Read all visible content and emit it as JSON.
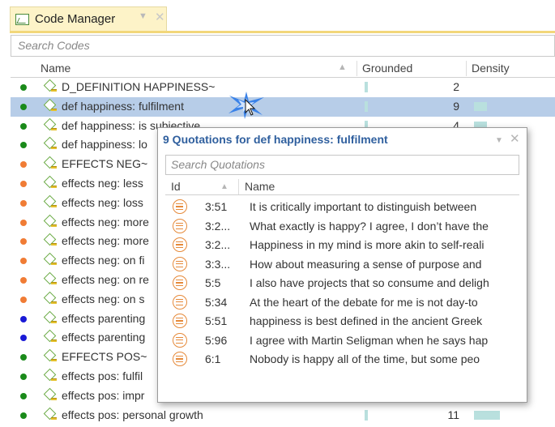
{
  "tab": {
    "title": "Code Manager",
    "dropdown_icon": "triangle-down-icon",
    "close_icon": "close-icon"
  },
  "search": {
    "placeholder": "Search Codes"
  },
  "columns": {
    "name": "Name",
    "grounded": "Grounded",
    "density": "Density"
  },
  "colors": {
    "tab_background": "#fdf3c8",
    "tab_underline": "#f2d77a",
    "selected_row": "#b7cde8",
    "bar": "#b9e0de",
    "popup_title": "#2f5f9e",
    "quotation_icon": "#e68a3a",
    "dot_green": "#1a8a1a",
    "dot_orange": "#f07c35",
    "dot_blue": "#1a1ad6"
  },
  "codes": [
    {
      "label": "D_DEFINITION HAPPINESS~",
      "color": "#1a8a1a",
      "grounded": "2",
      "density_level": 0,
      "selected": false
    },
    {
      "label": "def happiness: fulfilment",
      "color": "#1a8a1a",
      "grounded": "9",
      "density_level": 1,
      "selected": true
    },
    {
      "label": "def happiness: is subjective",
      "color": "#1a8a1a",
      "grounded": "4",
      "density_level": 1,
      "selected": false
    },
    {
      "label": "def happiness: lo",
      "color": "#1a8a1a",
      "grounded": "",
      "density_level": 0,
      "selected": false
    },
    {
      "label": "EFFECTS NEG~",
      "color": "#f07c35",
      "grounded": "",
      "density_level": 0,
      "selected": false
    },
    {
      "label": "effects neg: less",
      "color": "#f07c35",
      "grounded": "",
      "density_level": 0,
      "selected": false
    },
    {
      "label": "effects neg: loss",
      "color": "#f07c35",
      "grounded": "",
      "density_level": 0,
      "selected": false
    },
    {
      "label": "effects neg: more",
      "color": "#f07c35",
      "grounded": "",
      "density_level": 0,
      "selected": false
    },
    {
      "label": "effects neg: more",
      "color": "#f07c35",
      "grounded": "",
      "density_level": 0,
      "selected": false
    },
    {
      "label": "effects neg: on fi",
      "color": "#f07c35",
      "grounded": "",
      "density_level": 0,
      "selected": false
    },
    {
      "label": "effects neg: on re",
      "color": "#f07c35",
      "grounded": "",
      "density_level": 0,
      "selected": false
    },
    {
      "label": "effects neg: on s",
      "color": "#f07c35",
      "grounded": "",
      "density_level": 0,
      "selected": false
    },
    {
      "label": "effects parenting",
      "color": "#1a1ad6",
      "grounded": "",
      "density_level": 0,
      "selected": false
    },
    {
      "label": "effects parenting",
      "color": "#1a1ad6",
      "grounded": "",
      "density_level": 0,
      "selected": false
    },
    {
      "label": "EFFECTS POS~",
      "color": "#1a8a1a",
      "grounded": "",
      "density_level": 0,
      "selected": false
    },
    {
      "label": "effects pos: fulfil",
      "color": "#1a8a1a",
      "grounded": "",
      "density_level": 0,
      "selected": false
    },
    {
      "label": "effects pos: impr",
      "color": "#1a8a1a",
      "grounded": "",
      "density_level": 0,
      "selected": false
    },
    {
      "label": "effects pos: personal growth",
      "color": "#1a8a1a",
      "grounded": "11",
      "density_level": 2,
      "selected": false
    }
  ],
  "popup": {
    "title": "9 Quotations for def happiness: fulfilment",
    "search_placeholder": "Search Quotations",
    "col_id": "Id",
    "col_name": "Name",
    "quotations": [
      {
        "id": "3:51",
        "text": "It is critically important to distinguish between"
      },
      {
        "id": "3:2...",
        "text": "What exactly is happy? I agree, I don’t have the"
      },
      {
        "id": "3:2...",
        "text": "Happiness in my mind is more akin to self-reali"
      },
      {
        "id": "3:3...",
        "text": "How about measuring a sense of purpose and"
      },
      {
        "id": "5:5",
        "text": "I also have projects that so consume and deligh"
      },
      {
        "id": "5:34",
        "text": "At the heart of the debate for me is not day-to"
      },
      {
        "id": "5:51",
        "text": "happiness is best defined in the ancient Greek"
      },
      {
        "id": "5:96",
        "text": "I agree with Martin Seligman when he says hap"
      },
      {
        "id": "6:1",
        "text": "Nobody is happy all of the time, but some peo"
      }
    ]
  }
}
